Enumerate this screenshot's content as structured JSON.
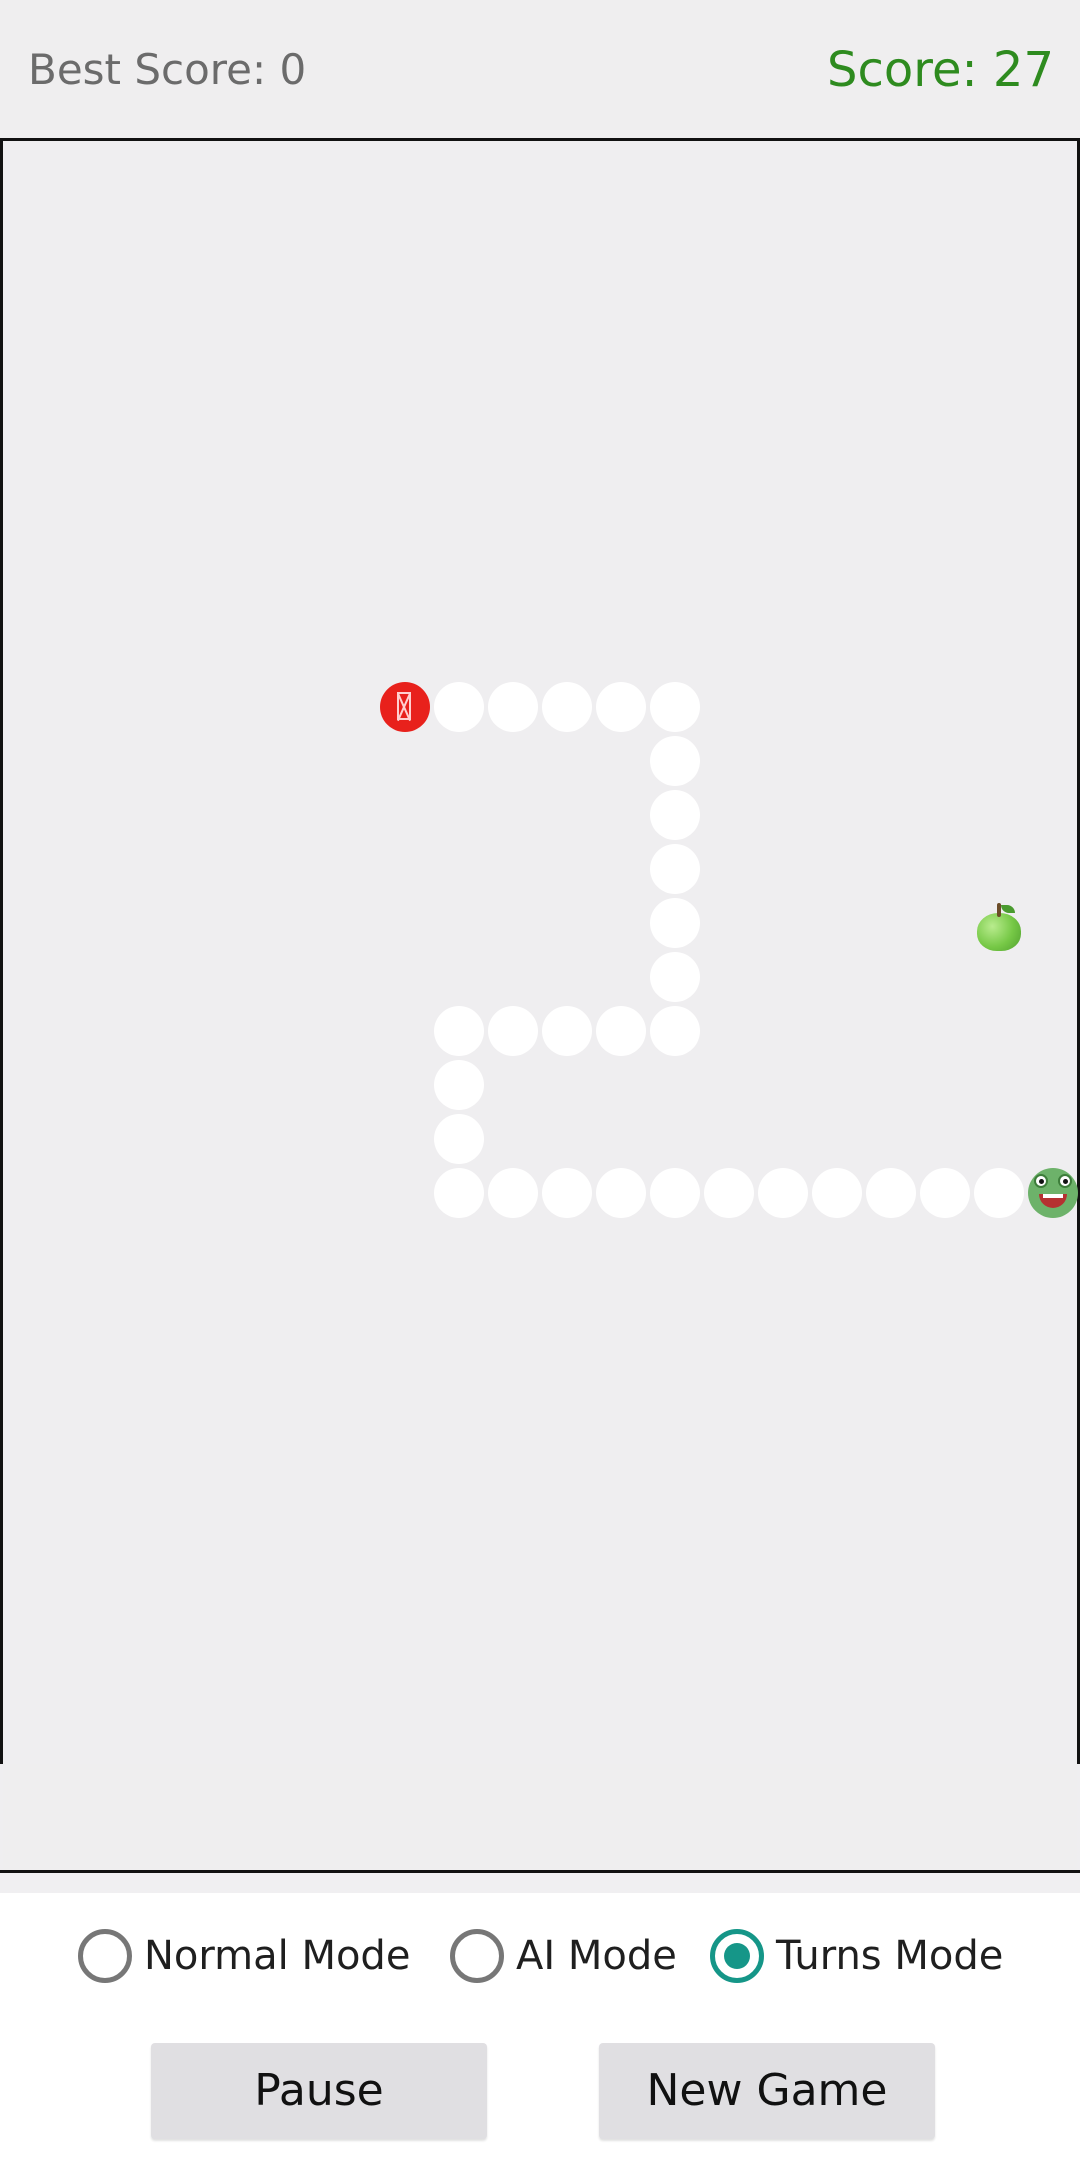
{
  "header": {
    "best_score": "Best Score: 0",
    "score": "Score: 27"
  },
  "game": {
    "snake_head_icon": "frog-face-icon",
    "snake_tail_icon": "missing-glyph-icon",
    "food_icon": "green-apple-icon",
    "snake_segment_count": 27
  },
  "modes": {
    "options": [
      {
        "label": "Normal Mode",
        "checked": false
      },
      {
        "label": "AI Mode",
        "checked": false
      },
      {
        "label": "Turns Mode",
        "checked": true
      }
    ]
  },
  "buttons": {
    "pause": "Pause",
    "new_game": "New Game"
  },
  "colors": {
    "score": "#2e8b1f",
    "best_score": "#6b6b6b",
    "radio_checked": "#159688",
    "tail": "#e8211c",
    "segment": "#ffffff",
    "button_bg": "#e0dfe2"
  }
}
